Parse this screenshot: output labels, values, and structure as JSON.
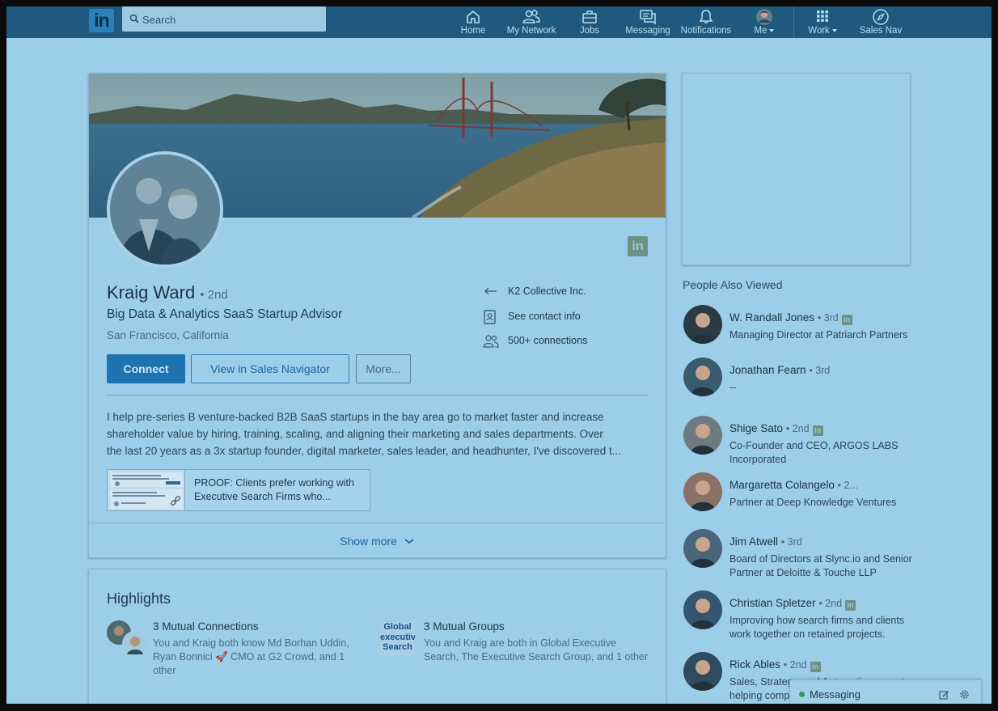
{
  "nav": {
    "logo": "in",
    "search_placeholder": "Search",
    "items": [
      {
        "label": "Home"
      },
      {
        "label": "My Network"
      },
      {
        "label": "Jobs"
      },
      {
        "label": "Messaging"
      },
      {
        "label": "Notifications"
      },
      {
        "label": "Me"
      },
      {
        "label": "Work"
      },
      {
        "label": "Sales Nav"
      }
    ]
  },
  "profile": {
    "name": "Kraig Ward",
    "degree": "• 2nd",
    "headline": "Big Data & Analytics SaaS Startup Advisor",
    "location": "San Francisco, California",
    "company": "K2 Collective Inc.",
    "contact_info": "See contact info",
    "connections": "500+ connections",
    "badge": "in",
    "buttons": {
      "connect": "Connect",
      "sales": "View in Sales Navigator",
      "more": "More..."
    },
    "summary": [
      "I help pre-series B venture-backed B2B SaaS startups in the bay area go to market faster and increase",
      "shareholder value by hiring, training, scaling, and aligning their marketing and sales departments. Over",
      "the last 20 years as a 3x startup founder, digital marketer, sales leader, and headhunter, I've discovered t..."
    ],
    "media_title": "PROOF: Clients prefer working with Executive Search Firms who...",
    "show_more": "Show more"
  },
  "highlights": {
    "title": "Highlights",
    "connections": {
      "heading": "3 Mutual Connections",
      "desc": "You and Kraig both know Md Borhan Uddin, Ryan Bonnici 🚀 CMO at G2 Crowd, and 1 other"
    },
    "groups": {
      "heading": "3 Mutual Groups",
      "desc": "You and Kraig are both in Global Executive Search, The Executive Search Group, and 1 other",
      "logo_text": "Global executive Search"
    }
  },
  "sidebar": {
    "title": "People Also Viewed",
    "people": [
      {
        "name": "W. Randall Jones",
        "degree": "• 3rd",
        "li": true,
        "headline": "Managing Director at Patriarch Partners",
        "color": "#2c3a44"
      },
      {
        "name": "Jonathan Fearn",
        "degree": "• 3rd",
        "li": false,
        "headline": "--",
        "color": "#3a5a6e"
      },
      {
        "name": "Shige Sato",
        "degree": "• 2nd",
        "li": true,
        "headline": "Co-Founder and CEO, ARGOS LABS Incorporated",
        "color": "#6d7b80"
      },
      {
        "name": "Margaretta Colangelo",
        "degree": "• 2...",
        "li": false,
        "headline": "Partner at Deep Knowledge Ventures",
        "color": "#8a7066"
      },
      {
        "name": "Jim Atwell",
        "degree": "• 3rd",
        "li": false,
        "headline": "Board of Directors at Slync.io and Senior Partner at Deloitte & Touche LLP",
        "color": "#48657a"
      },
      {
        "name": "Christian Spletzer",
        "degree": "• 2nd",
        "li": true,
        "headline": "Improving how search firms and clients work together on retained projects.",
        "color": "#355670"
      },
      {
        "name": "Rick Ables",
        "degree": "• 2nd",
        "li": true,
        "headline": "Sales, Strategy, and Automation expert helping comp",
        "color": "#2f4b60"
      }
    ]
  },
  "messaging": {
    "label": "Messaging"
  }
}
